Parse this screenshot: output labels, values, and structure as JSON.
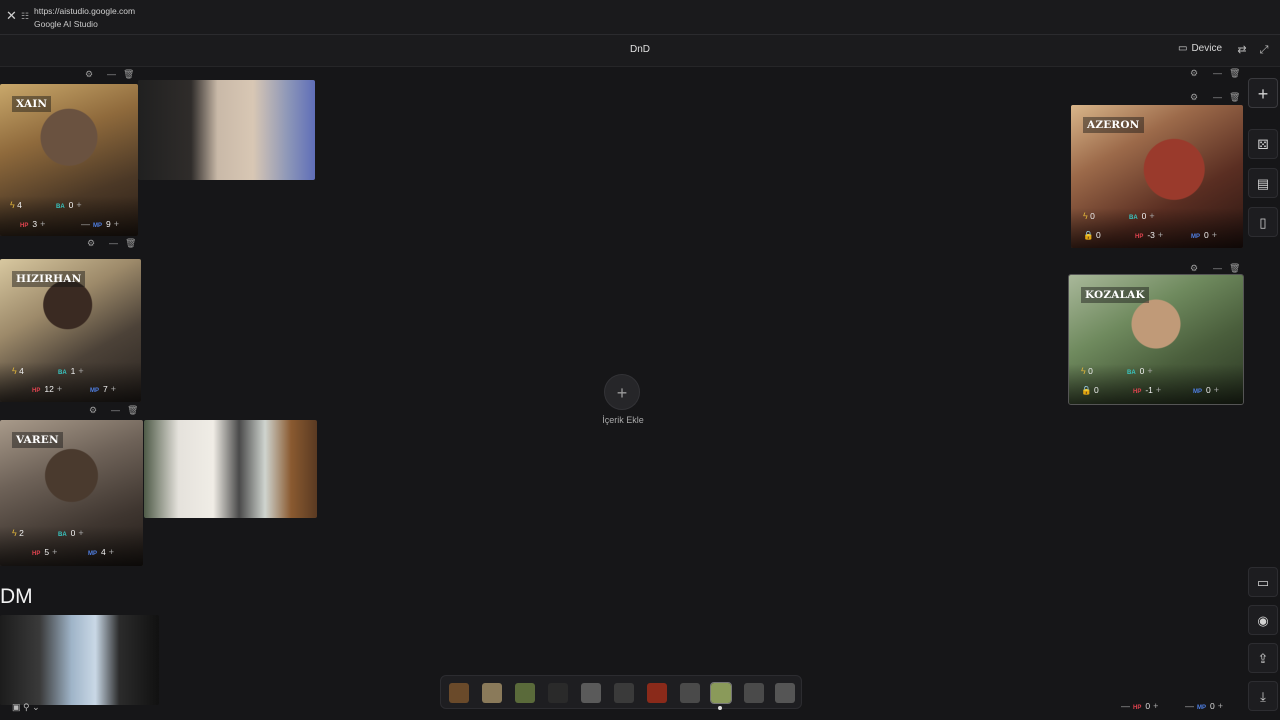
{
  "browser": {
    "url": "https://aistudio.google.com",
    "site_name": "Google AI Studio",
    "close_icon": "close-icon",
    "site_info_icon": "tune-icon"
  },
  "header": {
    "title": "DnD",
    "device_label": "Device",
    "icons": [
      "device-icon",
      "sync-icon",
      "fullscreen-icon"
    ]
  },
  "characters": [
    {
      "name": "XAIN",
      "bolt": "4",
      "ba": "0",
      "hp": "3",
      "mp": "9"
    },
    {
      "name": "HIZIRHAN",
      "bolt": "4",
      "ba": "1",
      "hp": "12",
      "mp": "7"
    },
    {
      "name": "VAREN",
      "bolt": "2",
      "ba": "0",
      "hp": "5",
      "mp": "4"
    },
    {
      "name": "AZERON",
      "bolt": "0",
      "ba": "0",
      "hp": "-3",
      "mp": "0",
      "lock": "0"
    },
    {
      "name": "KOZALAK",
      "bolt": "0",
      "ba": "0",
      "hp": "-1",
      "mp": "0",
      "lock": "0"
    }
  ],
  "center": {
    "add_label": "İçerik Ekle"
  },
  "dm": {
    "label": "DM",
    "hp": "0",
    "mp": "0",
    "hp_label": "HP",
    "mp_label": "MP"
  },
  "labels": {
    "ba": "BA",
    "hp": "HP",
    "mp": "MP"
  },
  "dock": {
    "icons": [
      "plus-icon",
      "dice-icon",
      "book-icon",
      "clipboard-icon",
      "monitor-icon",
      "eye-icon",
      "upload-icon",
      "download-icon"
    ]
  },
  "tray": {
    "thumbnail_count": 11,
    "active_index": 8
  },
  "colors": {
    "bg": "#161618",
    "ba": "#38c6c2",
    "hp": "#e0434f",
    "mp": "#4f7fe4",
    "bolt": "#e0b43a"
  }
}
